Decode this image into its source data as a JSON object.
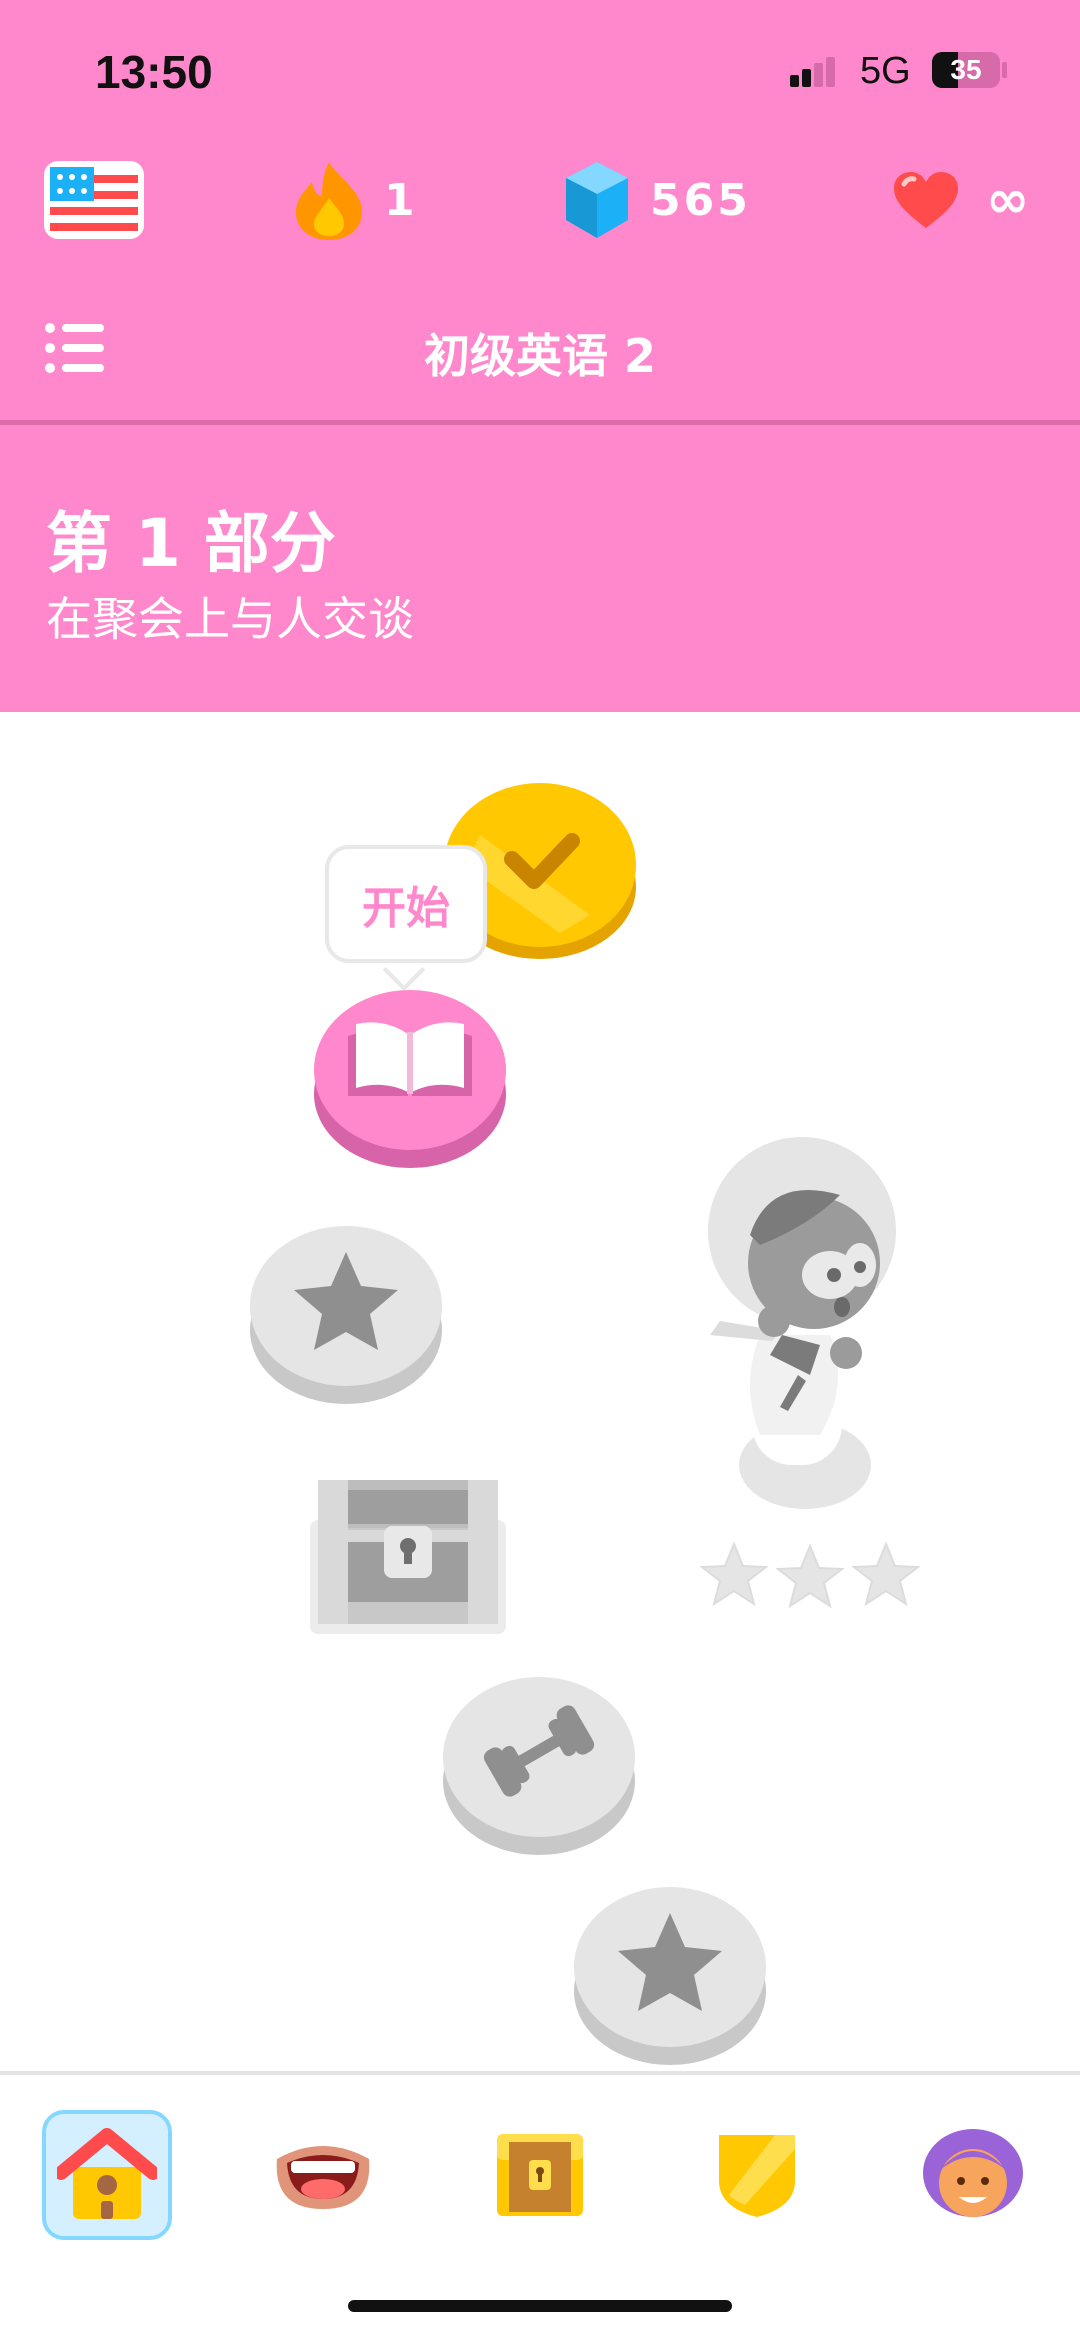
{
  "status_bar": {
    "time": "13:50",
    "network": "5G",
    "battery": "35"
  },
  "top_stats": {
    "streak": "1",
    "gems": "565",
    "hearts": "∞"
  },
  "course": {
    "title": "初级英语 2"
  },
  "section": {
    "title": "第 1 部分",
    "subtitle": "在聚会上与人交谈"
  },
  "path": {
    "start_tooltip": "开始"
  },
  "icons": {
    "flag": "us-flag-icon",
    "streak": "flame-icon",
    "gems": "gem-icon",
    "hearts": "heart-icon",
    "menu": "list-menu-icon"
  },
  "tabs": [
    {
      "name": "learn",
      "icon": "house-icon",
      "active": true
    },
    {
      "name": "speak",
      "icon": "mouth-icon"
    },
    {
      "name": "treasure",
      "icon": "treasure-chest-icon"
    },
    {
      "name": "league",
      "icon": "shield-icon"
    },
    {
      "name": "profile",
      "icon": "avatar-icon"
    }
  ],
  "colors": {
    "header": "#FF88CC",
    "gold": "#FFC800",
    "inactive": "#E5E5E5",
    "active_tab_bg": "#D4EFFF"
  }
}
